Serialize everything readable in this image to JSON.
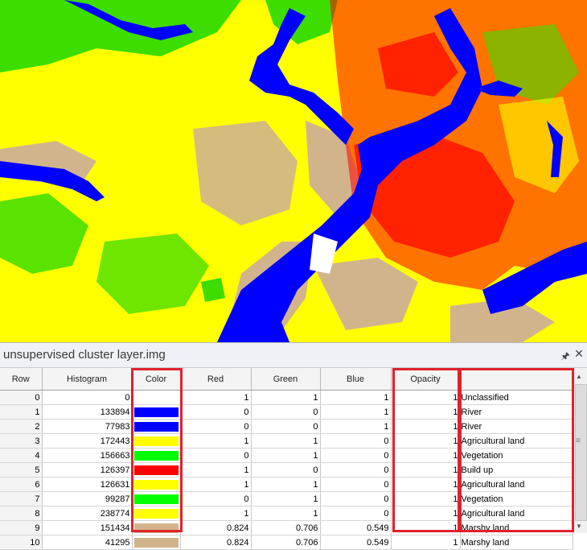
{
  "map": {
    "colors": {
      "vegetation": "#3ddd00",
      "agricultural": "#ffff00",
      "marshy": "#d2b48c",
      "river": "#0000ff",
      "buildup": "#ff0000",
      "unclassified": "#ffffff"
    }
  },
  "panel": {
    "title": "unsupervised cluster layer.img",
    "pin_icon": "pin-icon",
    "close_icon": "close-icon"
  },
  "table": {
    "headers": {
      "row": "Row",
      "histogram": "Histogram",
      "color": "Color",
      "red": "Red",
      "green": "Green",
      "blue": "Blue",
      "opacity": "Opacity",
      "class_name": ""
    },
    "rows": [
      {
        "row": "0",
        "histogram": "0",
        "color": "#ffffff",
        "red": "1",
        "green": "1",
        "blue": "1",
        "opacity": "1",
        "class_name": "Unclassified"
      },
      {
        "row": "1",
        "histogram": "133894",
        "color": "#0000ff",
        "red": "0",
        "green": "0",
        "blue": "1",
        "opacity": "1",
        "class_name": "River"
      },
      {
        "row": "2",
        "histogram": "77983",
        "color": "#0000ff",
        "red": "0",
        "green": "0",
        "blue": "1",
        "opacity": "1",
        "class_name": "River"
      },
      {
        "row": "3",
        "histogram": "172443",
        "color": "#ffff00",
        "red": "1",
        "green": "1",
        "blue": "0",
        "opacity": "1",
        "class_name": "Agricultural land"
      },
      {
        "row": "4",
        "histogram": "156663",
        "color": "#00ff00",
        "red": "0",
        "green": "1",
        "blue": "0",
        "opacity": "1",
        "class_name": "Vegetation"
      },
      {
        "row": "5",
        "histogram": "126397",
        "color": "#ff0000",
        "red": "1",
        "green": "0",
        "blue": "0",
        "opacity": "1",
        "class_name": "Build up"
      },
      {
        "row": "6",
        "histogram": "126631",
        "color": "#ffff00",
        "red": "1",
        "green": "1",
        "blue": "0",
        "opacity": "1",
        "class_name": "Agricultural land"
      },
      {
        "row": "7",
        "histogram": "99287",
        "color": "#00ff00",
        "red": "0",
        "green": "1",
        "blue": "0",
        "opacity": "1",
        "class_name": "Vegetation"
      },
      {
        "row": "8",
        "histogram": "238774",
        "color": "#ffff00",
        "red": "1",
        "green": "1",
        "blue": "0",
        "opacity": "1",
        "class_name": "Agricultural land"
      },
      {
        "row": "9",
        "histogram": "151434",
        "color": "#d2b48c",
        "red": "0.824",
        "green": "0.706",
        "blue": "0.549",
        "opacity": "1",
        "class_name": "Marshy land"
      },
      {
        "row": "10",
        "histogram": "41295",
        "color": "#d2b48c",
        "red": "0.824",
        "green": "0.706",
        "blue": "0.549",
        "opacity": "1",
        "class_name": "Marshy land"
      }
    ]
  },
  "highlight_color": "#e0222c"
}
